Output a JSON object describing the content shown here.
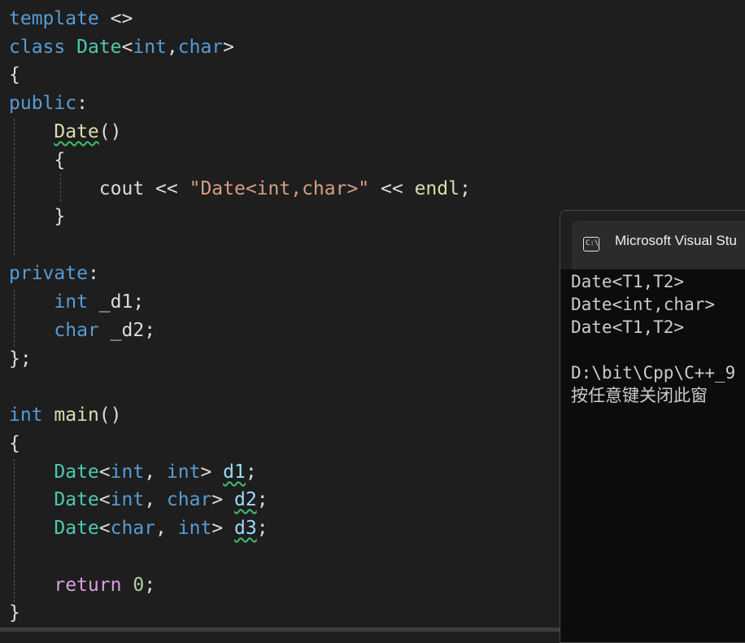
{
  "editor": {
    "l1": {
      "template": "template",
      "brackets": "<>"
    },
    "l2": {
      "class": "class",
      "name": "Date",
      "lt": "<",
      "int": "int",
      "comma": ",",
      "char": "char",
      "gt": ">"
    },
    "l3": {
      "brace": "{"
    },
    "l4": {
      "public": "public",
      "colon": ":"
    },
    "l5": {
      "ctor": "Date",
      "parens": "()"
    },
    "l6": {
      "brace": "{"
    },
    "l7": {
      "cout": "cout",
      "op1": "<<",
      "str": "\"Date<int,char>\"",
      "op2": "<<",
      "endl": "endl",
      "semi": ";"
    },
    "l8": {
      "brace": "}"
    },
    "l9": {
      "private": "private",
      "colon": ":"
    },
    "l10": {
      "type": "int",
      "var": "_d1",
      "semi": ";"
    },
    "l11": {
      "type": "char",
      "var": "_d2",
      "semi": ";"
    },
    "l12": {
      "close": "}",
      "semi": ";"
    },
    "l13": {
      "type": "int",
      "fn": "main",
      "parens": "()"
    },
    "l14": {
      "brace": "{"
    },
    "l15": {
      "cls": "Date",
      "lt": "<",
      "t1": "int",
      "comma": ",",
      "t2": "int",
      "gt": ">",
      "var": "d1",
      "semi": ";"
    },
    "l16": {
      "cls": "Date",
      "lt": "<",
      "t1": "int",
      "comma": ",",
      "t2": "char",
      "gt": ">",
      "var": "d2",
      "semi": ";"
    },
    "l17": {
      "cls": "Date",
      "lt": "<",
      "t1": "char",
      "comma": ",",
      "t2": "int",
      "gt": ">",
      "var": "d3",
      "semi": ";"
    },
    "l18": {
      "ret": "return",
      "num": "0",
      "semi": ";"
    },
    "l19": {
      "brace": "}"
    }
  },
  "console": {
    "icon_text": "C:\\",
    "title": "Microsoft Visual Stu",
    "output": [
      "Date<T1,T2>",
      "Date<int,char>",
      "Date<T1,T2>",
      "",
      "D:\\bit\\Cpp\\C++_9",
      "按任意键关闭此窗"
    ]
  }
}
